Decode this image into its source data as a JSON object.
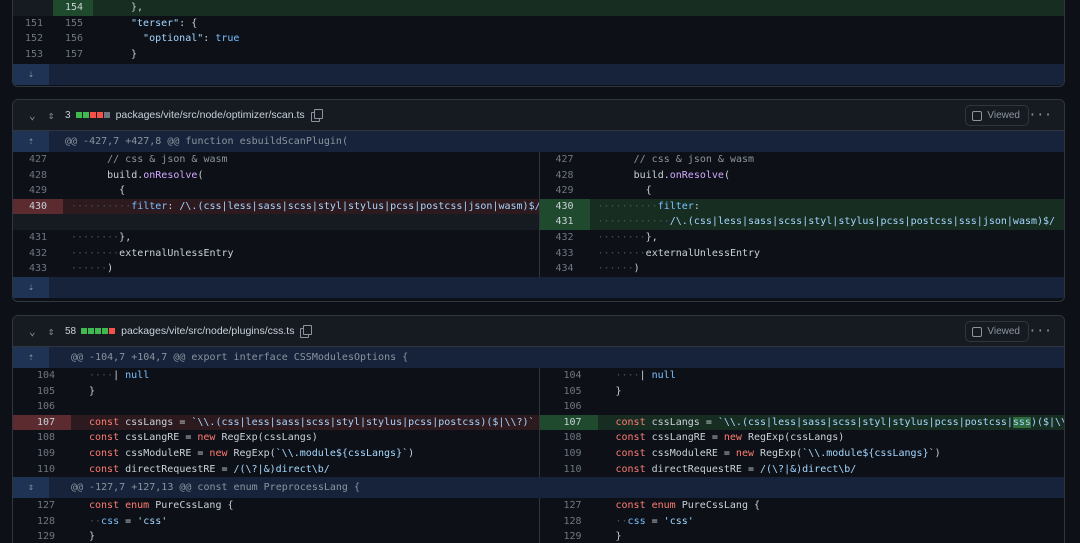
{
  "top_file": {
    "rows": [
      {
        "old": "",
        "new": "154",
        "code": "},",
        "type": "add"
      },
      {
        "old": "151",
        "new": "155",
        "code": "\"terser\": {",
        "type": "ctx"
      },
      {
        "old": "152",
        "new": "156",
        "code": "  \"optional\": true",
        "type": "ctx"
      },
      {
        "old": "153",
        "new": "157",
        "code": "}",
        "type": "ctx"
      }
    ],
    "expand_icon": "expand-down-icon"
  },
  "scan_file": {
    "count": "3",
    "path": "packages/vite/src/node/optimizer/scan.ts",
    "viewed_label": "Viewed",
    "bars": [
      "#3fb950",
      "#3fb950",
      "#f85149",
      "#f85149",
      "#6e7681"
    ],
    "hunk": "@@ -427,7 +427,8 @@ function esbuildScanPlugin(",
    "left": [
      {
        "ln": "427",
        "code": "      // css & json & wasm"
      },
      {
        "ln": "428",
        "code": "      build.onResolve("
      },
      {
        "ln": "429",
        "code": "        {"
      },
      {
        "ln": "430",
        "code": "··········filter: /\\.(css|less|sass|scss|styl|stylus|pcss|postcss|json|wasm)$/"
      },
      {
        "ln": "",
        "code": ""
      },
      {
        "ln": "431",
        "code": "········},"
      },
      {
        "ln": "432",
        "code": "········externalUnlessEntry"
      },
      {
        "ln": "433",
        "code": "······)"
      }
    ],
    "right": [
      {
        "ln": "427",
        "code": "      // css & json & wasm"
      },
      {
        "ln": "428",
        "code": "      build.onResolve("
      },
      {
        "ln": "429",
        "code": "        {"
      },
      {
        "ln": "430",
        "code": "··········filter:"
      },
      {
        "ln": "431",
        "code": "············/\\.(css|less|sass|scss|styl|stylus|pcss|postcss|sss|json|wasm)$/"
      },
      {
        "ln": "432",
        "code": "········},"
      },
      {
        "ln": "433",
        "code": "········externalUnlessEntry"
      },
      {
        "ln": "434",
        "code": "······)"
      }
    ]
  },
  "css_file": {
    "count": "58",
    "path": "packages/vite/src/node/plugins/css.ts",
    "viewed_label": "Viewed",
    "bars": [
      "#3fb950",
      "#3fb950",
      "#3fb950",
      "#3fb950",
      "#f85149"
    ],
    "hunk1": "@@ -104,7 +104,7 @@ export interface CSSModulesOptions {",
    "hunk2": "@@ -127,7 +127,13 @@ const enum PreprocessLang {",
    "left": [
      {
        "ln": "104",
        "code": "····| null"
      },
      {
        "ln": "105",
        "code": "}"
      },
      {
        "ln": "106",
        "code": ""
      },
      {
        "ln": "107",
        "code": "const cssLangs = `\\\\.(css|less|sass|scss|styl|stylus|pcss|postcss)($|\\\\?)`"
      },
      {
        "ln": "108",
        "code": "const cssLangRE = new RegExp(cssLangs)"
      },
      {
        "ln": "109",
        "code": "const cssModuleRE = new RegExp(`\\\\.module${cssLangs}`)"
      },
      {
        "ln": "110",
        "code": "const directRequestRE = /(\\?|&)direct\\b/"
      }
    ],
    "right": [
      {
        "ln": "104",
        "code": "····| null"
      },
      {
        "ln": "105",
        "code": "}"
      },
      {
        "ln": "106",
        "code": ""
      },
      {
        "ln": "107",
        "code": "const cssLangs = `\\\\.(css|less|sass|scss|styl|stylus|pcss|postcss|sss)($|\\\\?)`"
      },
      {
        "ln": "108",
        "code": "const cssLangRE = new RegExp(cssLangs)"
      },
      {
        "ln": "109",
        "code": "const cssModuleRE = new RegExp(`\\\\.module${cssLangs}`)"
      },
      {
        "ln": "110",
        "code": "const directRequestRE = /(\\?|&)direct\\b/"
      }
    ],
    "left2": [
      {
        "ln": "127",
        "code": "const enum PureCssLang {"
      },
      {
        "ln": "128",
        "code": "··css = 'css'"
      },
      {
        "ln": "129",
        "code": "}"
      }
    ],
    "right2": [
      {
        "ln": "127",
        "code": "const enum PureCssLang {"
      },
      {
        "ln": "128",
        "code": "··css = 'css'"
      },
      {
        "ln": "129",
        "code": "}"
      }
    ]
  }
}
